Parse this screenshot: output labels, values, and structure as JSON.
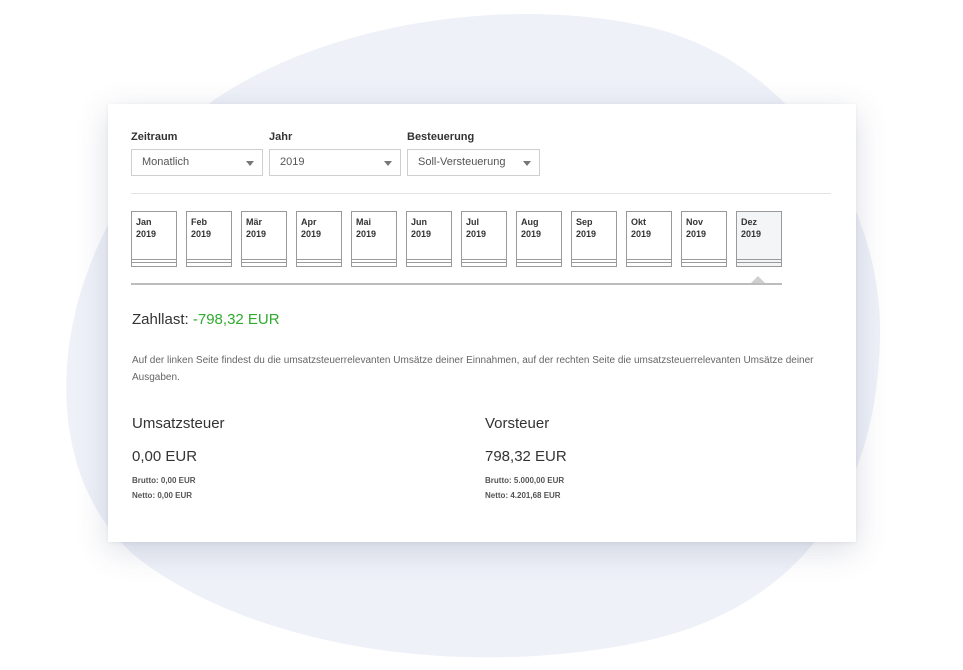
{
  "filters": {
    "zeitraum": {
      "label": "Zeitraum",
      "value": "Monatlich"
    },
    "jahr": {
      "label": "Jahr",
      "value": "2019"
    },
    "besteuerung": {
      "label": "Besteuerung",
      "value": "Soll-Versteuerung"
    }
  },
  "months": [
    {
      "name": "Jan",
      "year": "2019"
    },
    {
      "name": "Feb",
      "year": "2019"
    },
    {
      "name": "Mär",
      "year": "2019"
    },
    {
      "name": "Apr",
      "year": "2019"
    },
    {
      "name": "Mai",
      "year": "2019"
    },
    {
      "name": "Jun",
      "year": "2019"
    },
    {
      "name": "Jul",
      "year": "2019"
    },
    {
      "name": "Aug",
      "year": "2019"
    },
    {
      "name": "Sep",
      "year": "2019"
    },
    {
      "name": "Okt",
      "year": "2019"
    },
    {
      "name": "Nov",
      "year": "2019"
    },
    {
      "name": "Dez",
      "year": "2019"
    }
  ],
  "selected_month": "Dez",
  "zahllast": {
    "label": "Zahllast:",
    "value": "-798,32 EUR",
    "value_color": "#2eaa2e"
  },
  "info_text": "Auf der linken Seite findest du die umsatzsteuerrelevanten Umsätze deiner Einnahmen, auf der rechten Seite die umsatzsteuerrelevanten Umsätze deiner Ausgaben.",
  "umsatzsteuer": {
    "title": "Umsatzsteuer",
    "amount": "0,00 EUR",
    "brutto": "Brutto: 0,00 EUR",
    "netto": "Netto: 0,00 EUR"
  },
  "vorsteuer": {
    "title": "Vorsteuer",
    "amount": "798,32 EUR",
    "brutto": "Brutto: 5.000,00 EUR",
    "netto": "Netto: 4.201,68 EUR"
  },
  "colors": {
    "accent_green": "#2eaa2e",
    "background_blob": "#eef1f8"
  }
}
